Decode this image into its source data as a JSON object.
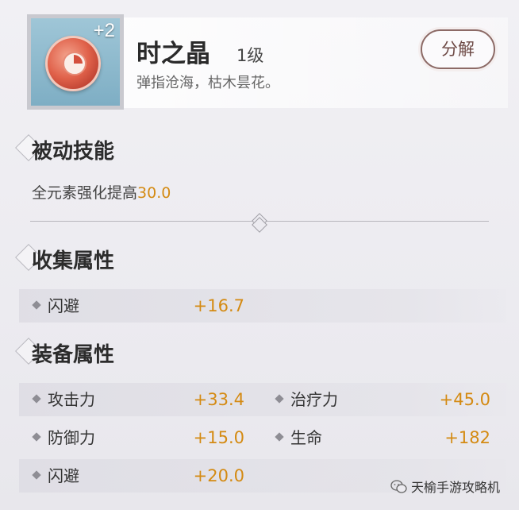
{
  "item": {
    "name": "时之晶",
    "level": "1级",
    "plus_level": "+2",
    "description": "弹指沧海，枯木昙花。",
    "decompose_label": "分解",
    "icon": "red-crystal-gem-icon"
  },
  "passive": {
    "title": "被动技能",
    "text": "全元素强化提高",
    "value": "30.0"
  },
  "collection": {
    "title": "收集属性",
    "stats": [
      {
        "label": "闪避",
        "value": "+16.7"
      }
    ]
  },
  "equipment": {
    "title": "装备属性",
    "stats": [
      {
        "label": "攻击力",
        "value": "+33.4"
      },
      {
        "label": "治疗力",
        "value": "+45.0"
      },
      {
        "label": "防御力",
        "value": "+15.0"
      },
      {
        "label": "生命",
        "value": "+182"
      },
      {
        "label": "闪避",
        "value": "+20.0"
      }
    ]
  },
  "watermark": "天榆手游攻略机",
  "colors": {
    "accent_value": "#d48a12",
    "button_border": "#8c6a66",
    "background": "#ecebf0"
  }
}
